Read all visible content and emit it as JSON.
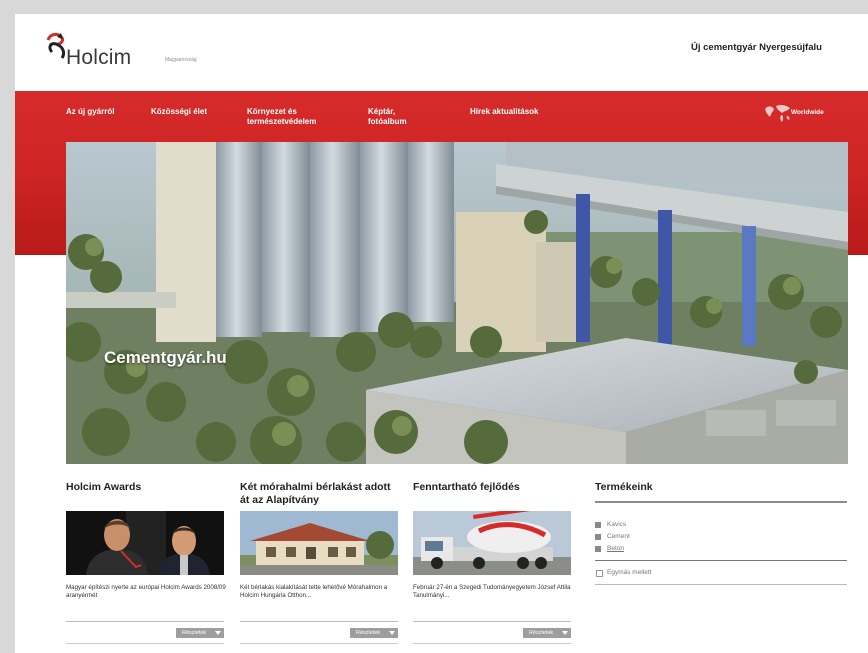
{
  "header": {
    "logo_text": "Holcim",
    "country": "Magyarország",
    "tagline": "Új cementgyár Nyergesújfalu"
  },
  "nav": {
    "items": [
      {
        "label": "Az új gyárról"
      },
      {
        "label": "Közösségi élet"
      },
      {
        "label": "Környezet és természetvédelem"
      },
      {
        "label": "Képtár, fotóalbum"
      },
      {
        "label": "Hírek aktualitások"
      }
    ],
    "worldwide": "Worldwide"
  },
  "hero": {
    "title": "Cementgyár.hu"
  },
  "columns": [
    {
      "title": "Holcim Awards",
      "text": "Magyar építészi nyerte az európai Holcim Awards 2008/09 aranyérmét",
      "more": "Részletek"
    },
    {
      "title": "Két mórahalmi bérlakást adott át az Alapítvány",
      "text": "Két bérlakás kialakítását tette lehetővé Mórahalmon a Holcim Hungária Otthon...",
      "more": "Részletek"
    },
    {
      "title": "Fenntartható fejlődés",
      "text": "Február 27-én a Szegedi Tudományegyetem József Attila Tanulmányi...",
      "more": "Részletek"
    }
  ],
  "products": {
    "title": "Termékeink",
    "items": [
      "Kavics",
      "Cement",
      "Beton"
    ],
    "compare": "Egymás mellett"
  },
  "colors": {
    "brand_red": "#cf2525",
    "background_gray": "#d8d8d8",
    "button_gray": "#9e9e9e"
  }
}
